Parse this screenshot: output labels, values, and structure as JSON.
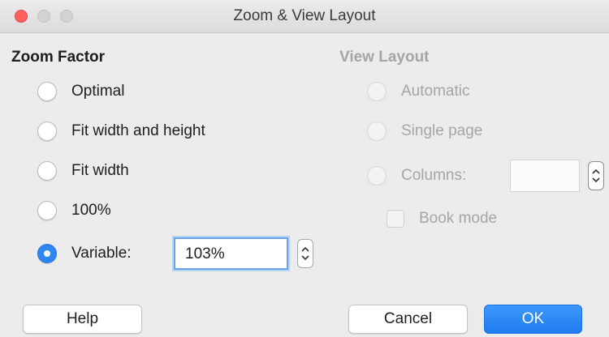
{
  "window": {
    "title": "Zoom & View Layout",
    "controls": [
      "close-icon",
      "minimize-icon",
      "maximize-icon"
    ]
  },
  "zoom_factor": {
    "heading": "Zoom Factor",
    "options": [
      {
        "label": "Optimal",
        "selected": false
      },
      {
        "label": "Fit width and height",
        "selected": false
      },
      {
        "label": "Fit width",
        "selected": false
      },
      {
        "label": "100%",
        "selected": false
      },
      {
        "label": "Variable:",
        "selected": true
      }
    ],
    "variable_value": "103%"
  },
  "view_layout": {
    "heading": "View Layout",
    "enabled": false,
    "options": [
      {
        "label": "Automatic",
        "selected": false
      },
      {
        "label": "Single page",
        "selected": false
      },
      {
        "label": "Columns:",
        "selected": false
      }
    ],
    "columns_value": "",
    "book_mode_label": "Book mode",
    "book_mode_checked": false
  },
  "buttons": {
    "help": "Help",
    "cancel": "Cancel",
    "ok": "OK"
  },
  "colors": {
    "accent": "#2f86f3",
    "background": "#ececec",
    "close": "#fc605c",
    "disabled_text": "#a5a5a5"
  }
}
